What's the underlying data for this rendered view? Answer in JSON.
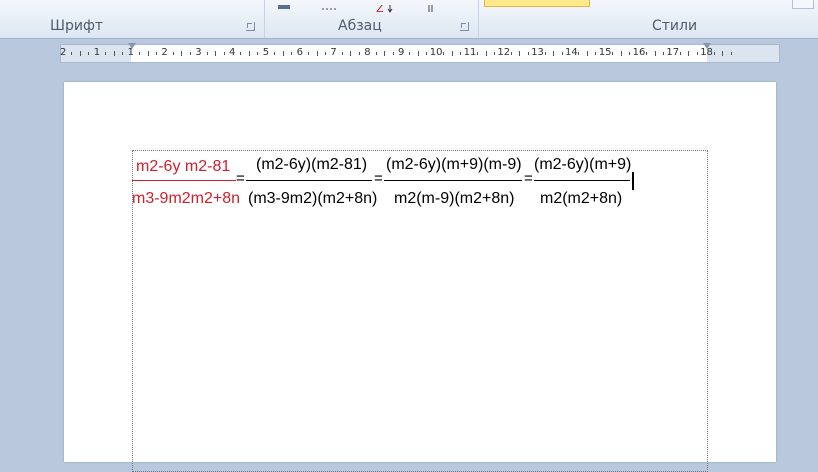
{
  "ribbon": {
    "groups": [
      {
        "label": "Шрифт"
      },
      {
        "label": "Абзац"
      },
      {
        "label": "Стили"
      }
    ]
  },
  "ruler": {
    "numbers": [
      "2",
      "1",
      "1",
      "2",
      "3",
      "4",
      "5",
      "6",
      "7",
      "8",
      "9",
      "10",
      "11",
      "12",
      "13",
      "14",
      "15",
      "16",
      "17",
      "18"
    ]
  },
  "document": {
    "frac1_num": "m2-6y  m2-81",
    "frac1_den": "m3-9m2m2+8n",
    "frac2_num": "(m2-6y)(m2-81)",
    "frac2_den": "(m3-9m2)(m2+8n)",
    "frac3_num": "(m2-6y)(m+9)(m-9)",
    "frac3_den": "m2(m-9)(m2+8n)",
    "frac4_num": "(m2-6y)(m+9)",
    "frac4_den": "m2(m2+8n)",
    "equals": "="
  }
}
